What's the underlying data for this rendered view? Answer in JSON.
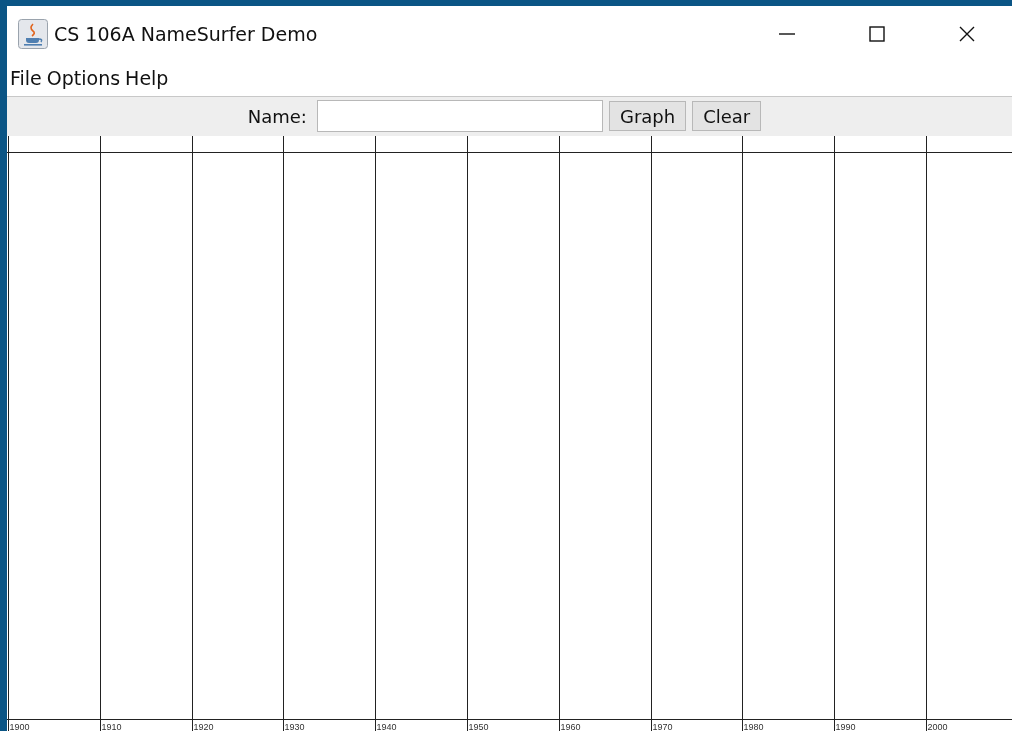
{
  "window": {
    "title": "CS 106A NameSurfer Demo"
  },
  "menu": [
    "File",
    "Options",
    "Help"
  ],
  "toolbar": {
    "label": "Name:",
    "buttons": [
      "Graph",
      "Clear"
    ]
  },
  "graph": {
    "decades": [
      "1900",
      "1910",
      "1920",
      "1930",
      "1940",
      "1950",
      "1960",
      "1970",
      "1980",
      "1990",
      "2000"
    ]
  }
}
